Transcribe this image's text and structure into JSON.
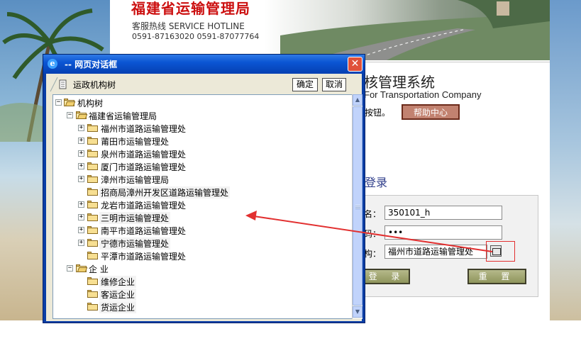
{
  "background_page": {
    "bureau_name": "福建省运输管理局",
    "hotline_line1": "客服热线 SERVICE HOTLINE",
    "hotline_line2": "0591-87163020  0591-87077764",
    "system_title": "核管理系统",
    "system_subtitle": "For Transportation Company",
    "press_text": "按钮。",
    "help_button": "帮助中心",
    "login_title": "登录",
    "username_label": "名：",
    "username_value": "350101_h",
    "password_label": "码：",
    "password_value": "•••",
    "org_label": "构：",
    "org_value": "福州市道路运输管理处",
    "login_button": "登 录",
    "reset_button": "重 置"
  },
  "dialog": {
    "title": "--  网页对话框",
    "close_symbol": "✕",
    "toolbar_title": "运政机构树",
    "ok_button": "确定",
    "cancel_button": "取消",
    "tree": {
      "root": "机构树",
      "groups": [
        {
          "label": "福建省运输管理局",
          "children": [
            {
              "label": "福州市道路运输管理处",
              "expandable": true
            },
            {
              "label": "莆田市运输管理处",
              "expandable": true
            },
            {
              "label": "泉州市道路运输管理处",
              "expandable": true
            },
            {
              "label": "厦门市道路运输管理处",
              "expandable": true
            },
            {
              "label": "漳州市运输管理局",
              "expandable": true
            },
            {
              "label": "招商局漳州开发区道路运输管理处",
              "expandable": false
            },
            {
              "label": "龙岩市道路运输管理处",
              "expandable": true
            },
            {
              "label": "三明市运输管理处",
              "expandable": true
            },
            {
              "label": "南平市道路运输管理处",
              "expandable": true
            },
            {
              "label": "宁德市运输管理处",
              "expandable": true
            },
            {
              "label": "平潭市道路运输管理处",
              "expandable": false
            }
          ]
        },
        {
          "label": "企 业",
          "children": [
            {
              "label": "维修企业",
              "expandable": false
            },
            {
              "label": "客运企业",
              "expandable": false
            },
            {
              "label": "货运企业",
              "expandable": false
            }
          ]
        }
      ]
    }
  },
  "colors": {
    "dialog_titlebar": "#0b55d3",
    "annotation_red": "#e23030",
    "bureau_red": "#cc1010",
    "help_button": "#c28270"
  }
}
